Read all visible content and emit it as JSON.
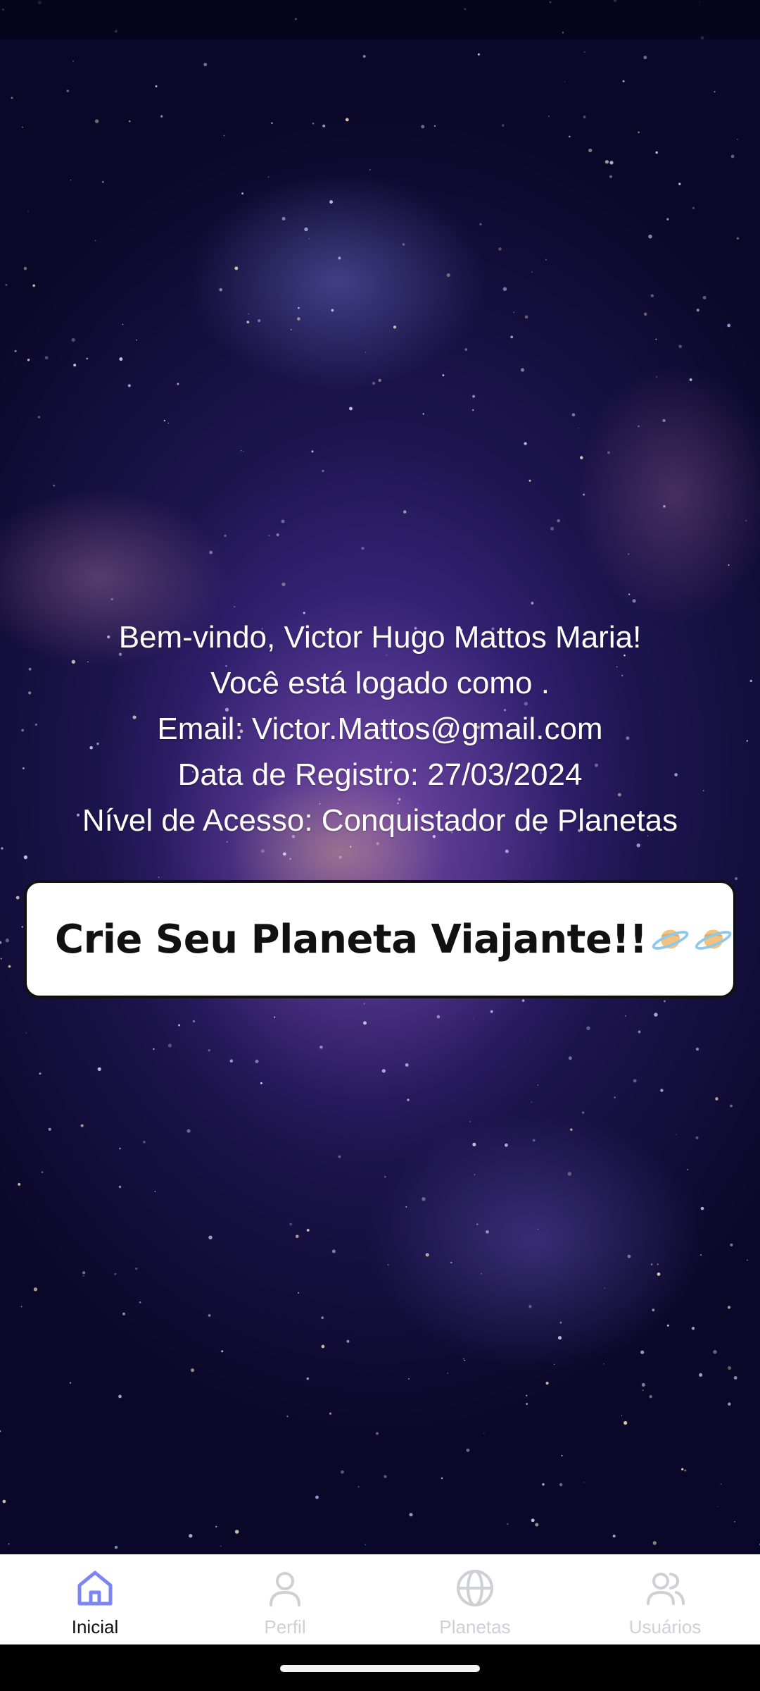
{
  "welcome": {
    "line1": "Bem-vindo, Victor Hugo Mattos Maria!",
    "line2": "Você está logado como .",
    "line3": "Email: Victor.Mattos@gmail.com",
    "line4": "Data de Registro: 27/03/2024",
    "line5": "Nível de Acesso: Conquistador de Planetas"
  },
  "cta": {
    "label": "Crie Seu Planeta Viajante!!",
    "icons": [
      "ringed-planet-icon",
      "ringed-planet-icon"
    ]
  },
  "tabs": [
    {
      "label": "Inicial",
      "icon": "home-icon",
      "active": true
    },
    {
      "label": "Perfil",
      "icon": "person-icon",
      "active": false
    },
    {
      "label": "Planetas",
      "icon": "globe-icon",
      "active": false
    },
    {
      "label": "Usuários",
      "icon": "users-icon",
      "active": false
    }
  ],
  "colors": {
    "active_tab": "#7b86f2",
    "inactive_tab": "#cfcfd6",
    "background": "#2a1f6b"
  }
}
